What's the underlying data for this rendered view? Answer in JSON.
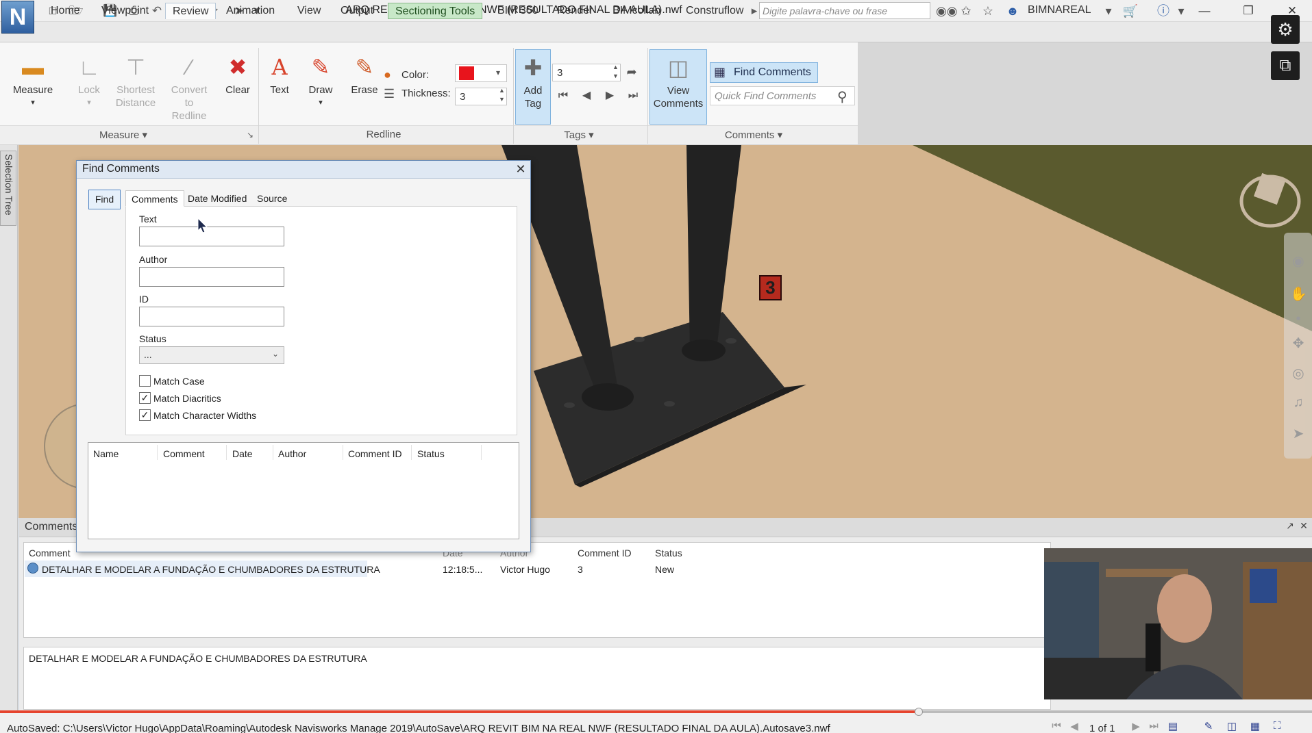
{
  "window": {
    "title": "ARQ REVIT BIM NA REAL NWF (RESULTADO FINAL DA AULA).nwf",
    "search_placeholder": "Digite palavra-chave ou frase",
    "user": "BIMNAREAL",
    "logo_letter": "N"
  },
  "menu_tabs": [
    "Home",
    "Viewpoint",
    "Review",
    "Animation",
    "View",
    "Output",
    "Sectioning Tools",
    "BIM 360",
    "Render",
    "BIMcollab",
    "Construflow"
  ],
  "ribbon": {
    "measure": {
      "title": "Measure",
      "measure": "Measure",
      "lock": "Lock",
      "shortest_1": "Shortest",
      "shortest_2": "Distance",
      "convert_1": "Convert",
      "convert_2": "to Redline",
      "clear": "Clear"
    },
    "redline": {
      "title": "Redline",
      "text": "Text",
      "draw": "Draw",
      "erase": "Erase",
      "color_label": "Color:",
      "color_value": "#e8141c",
      "thickness_label": "Thickness:",
      "thickness_value": "3"
    },
    "tags": {
      "title": "Tags",
      "add_tag_1": "Add",
      "add_tag_2": "Tag",
      "tag_id": "3"
    },
    "comments": {
      "title": "Comments",
      "view_1": "View",
      "view_2": "Comments",
      "find_comments": "Find Comments",
      "quick_find_placeholder": "Quick Find Comments"
    }
  },
  "side_tab": {
    "label": "Selection Tree"
  },
  "viewport": {
    "tag_number": "3"
  },
  "find_dialog": {
    "title": "Find Comments",
    "find_button": "Find",
    "tabs": [
      "Comments",
      "Date Modified",
      "Source"
    ],
    "fields": {
      "text_label": "Text",
      "author_label": "Author",
      "id_label": "ID",
      "status_label": "Status",
      "status_value": "..."
    },
    "checkboxes": [
      {
        "label": "Match Case",
        "checked": false
      },
      {
        "label": "Match Diacritics",
        "checked": true
      },
      {
        "label": "Match Character Widths",
        "checked": true
      }
    ],
    "results_columns": [
      "Name",
      "Comment",
      "Date",
      "Author",
      "Comment ID",
      "Status"
    ]
  },
  "comments_panel": {
    "title": "Comments",
    "columns": [
      "Comment",
      "Date",
      "Author",
      "Comment ID",
      "Status"
    ],
    "rows": [
      {
        "comment": "DETALHAR E MODELAR A FUNDAÇÃO E CHUMBADORES DA ESTRUTURA",
        "date": "12:18:5...",
        "author": "Victor Hugo",
        "comment_id": "3",
        "status": "New"
      }
    ],
    "body_text": "DETALHAR E MODELAR A FUNDAÇÃO E CHUMBADORES DA ESTRUTURA"
  },
  "statusbar": {
    "path": "AutoSaved: C:\\Users\\Victor Hugo\\AppData\\Roaming\\Autodesk Navisworks Manage 2019\\AutoSave\\ARQ REVIT BIM NA REAL NWF (RESULTADO FINAL DA AULA).Autosave3.nwf",
    "page": "1 of 1",
    "progress_percent": 70
  },
  "colors": {
    "accent": "#cce4f7",
    "context_tab": "#c8e8c8",
    "tag_marker": "#b52a1e"
  }
}
